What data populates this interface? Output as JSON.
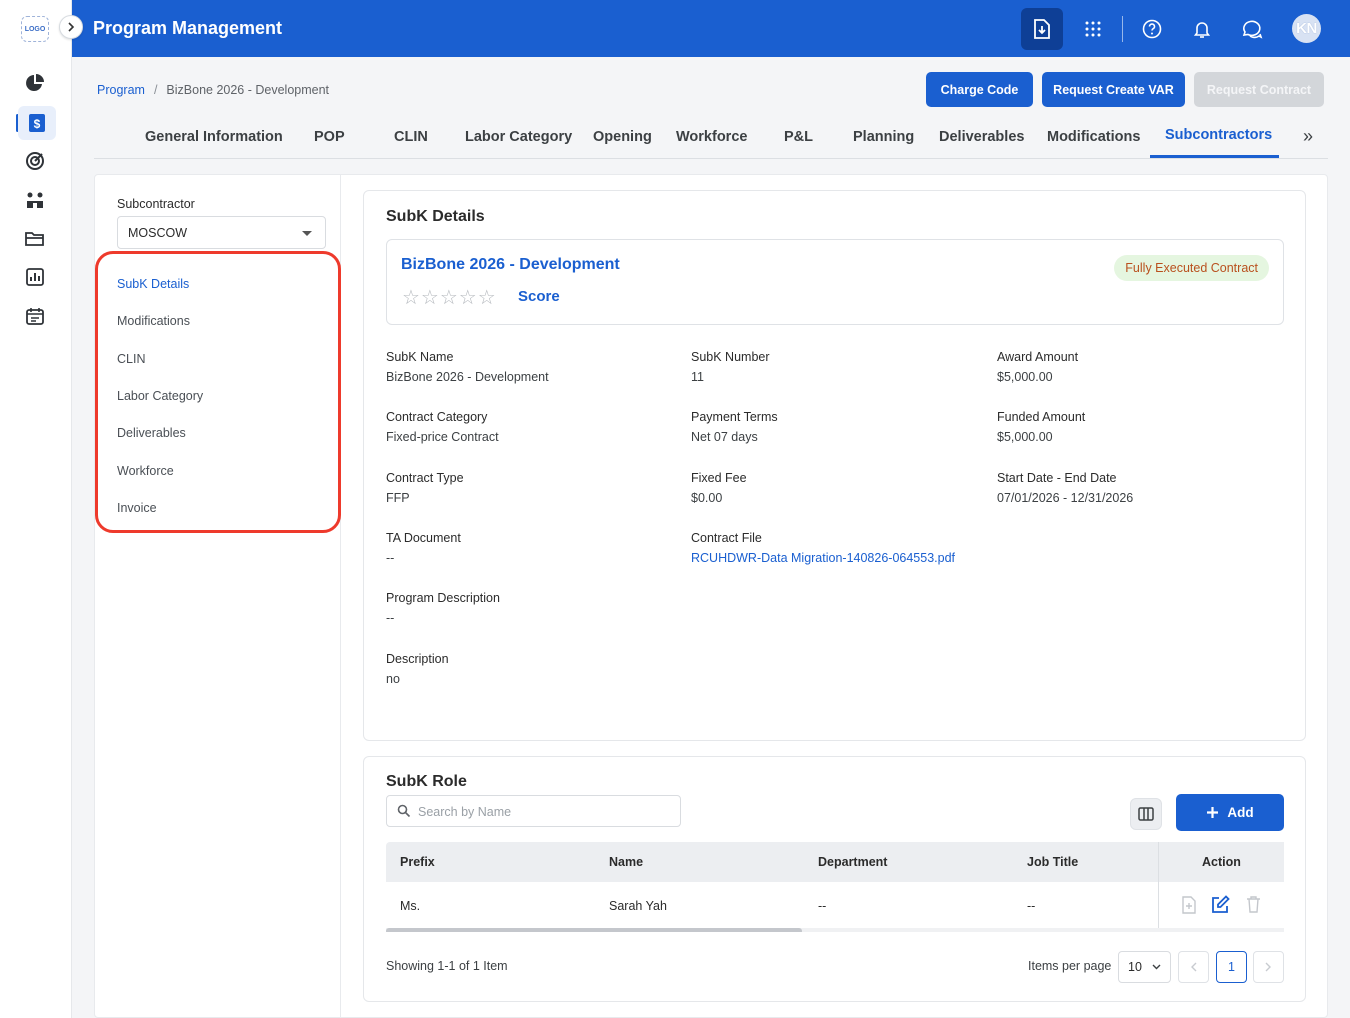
{
  "app": {
    "logo_text": "LOGO",
    "title": "Program Management",
    "user_initials": "KN"
  },
  "colors": {
    "brand": "#1a5fd0",
    "highlight": "#ee3a2c",
    "badge_bg": "#e5f6e0",
    "badge_text": "#b9501e"
  },
  "icons": {
    "rail": [
      "pie-chart-icon",
      "dollar-document-icon",
      "target-icon",
      "team-icon",
      "folder-icon",
      "report-chart-icon",
      "calendar-icon"
    ],
    "topbar": [
      "download-document-icon",
      "apps-grid-icon",
      "help-icon",
      "bell-icon",
      "chat-icon"
    ]
  },
  "breadcrumb": {
    "root": "Program",
    "separator": "/",
    "current": "BizBone 2026 - Development"
  },
  "actions": {
    "charge_code": "Charge Code",
    "request_create_var": "Request Create VAR",
    "request_contract": "Request Contract"
  },
  "tabs": [
    "General Information",
    "POP",
    "CLIN",
    "Labor Category",
    "Opening",
    "Workforce",
    "P&L",
    "Planning",
    "Deliverables",
    "Modifications",
    "Subcontractors"
  ],
  "tabs_more": "»",
  "sidebar": {
    "subcontractor_label": "Subcontractor",
    "subcontractor_value": "MOSCOW",
    "items": [
      "SubK Details",
      "Modifications",
      "CLIN",
      "Labor Category",
      "Deliverables",
      "Workforce",
      "Invoice"
    ],
    "active_item": "SubK Details"
  },
  "details": {
    "section_title": "SubK Details",
    "contract_title": "BizBone 2026 - Development",
    "stars": "☆☆☆☆☆",
    "score_label": "Score",
    "status_badge": "Fully Executed Contract",
    "fields": [
      {
        "label": "SubK Name",
        "value": "BizBone 2026 - Development"
      },
      {
        "label": "SubK Number",
        "value": "11"
      },
      {
        "label": "Award Amount",
        "value": "$5,000.00"
      },
      {
        "label": "Contract Category",
        "value": "Fixed-price Contract"
      },
      {
        "label": "Payment Terms",
        "value": "Net 07 days"
      },
      {
        "label": "Funded Amount",
        "value": "$5,000.00"
      },
      {
        "label": "Contract Type",
        "value": "FFP"
      },
      {
        "label": "Fixed Fee",
        "value": "$0.00"
      },
      {
        "label": "Start Date - End Date",
        "value": "07/01/2026 - 12/31/2026"
      },
      {
        "label": "TA Document",
        "value": "--"
      },
      {
        "label": "Contract File",
        "value": "RCUHDWR-Data Migration-140826-064553.pdf"
      },
      {
        "label": "Program Description",
        "value": "--"
      },
      {
        "label": "Description",
        "value": "no"
      }
    ]
  },
  "role": {
    "section_title": "SubK Role",
    "search_placeholder": "Search by Name",
    "add_label": "Add",
    "columns": [
      "Prefix",
      "Name",
      "Department",
      "Job Title",
      "Action"
    ],
    "rows": [
      {
        "prefix": "Ms.",
        "name": "Sarah Yah",
        "department": "--",
        "job_title": "--"
      }
    ],
    "showing": "Showing 1-1 of 1 Item",
    "items_per_page_label": "Items per page",
    "items_per_page": "10",
    "current_page": "1"
  }
}
